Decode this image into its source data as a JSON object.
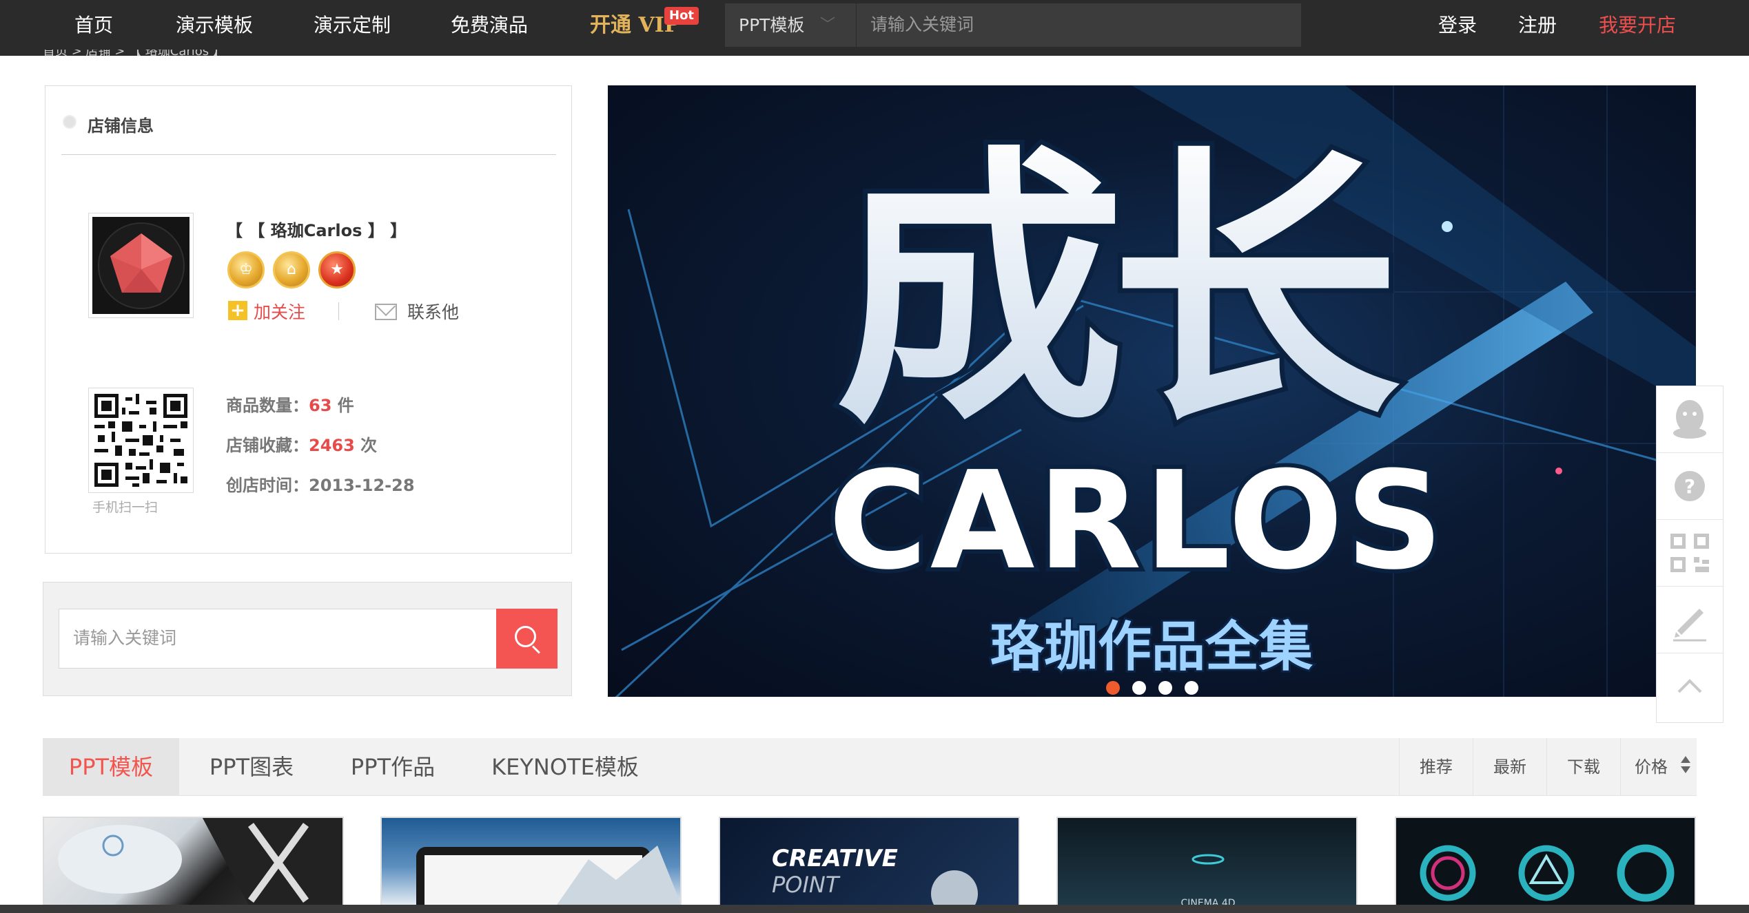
{
  "nav": {
    "items": [
      "首页",
      "演示模板",
      "演示定制",
      "免费演品"
    ],
    "vip_label": "开通 VIP",
    "hot_badge": "Hot",
    "search_category": "PPT模板",
    "search_placeholder": "请输入关键词",
    "login": "登录",
    "register": "注册",
    "open_shop": "我要开店"
  },
  "breadcrumb": "首页 > 店铺 > 【 珞珈Carlos 】",
  "shop": {
    "section_title": "店铺信息",
    "name": "【 【 珞珈Carlos 】 】",
    "follow": "加关注",
    "contact": "联系他",
    "qr_caption": "手机扫一扫",
    "goods_label": "商品数量：",
    "goods_value": "63",
    "goods_unit": " 件",
    "favs_label": "店铺收藏：",
    "favs_value": "2463",
    "favs_unit": " 次",
    "created_label": "创店时间：",
    "created_value": "2013-12-28"
  },
  "side_search": {
    "placeholder": "请输入关键词"
  },
  "banner": {
    "headline": "成长",
    "name": "CARLOS",
    "subtitle": "珞珈作品全集",
    "slide_count": 4,
    "active_slide": 1
  },
  "float_tools": [
    "qq-icon",
    "help-icon",
    "qrcode-icon",
    "edit-icon",
    "back-to-top-icon"
  ],
  "tabs": [
    "PPT模板",
    "PPT图表",
    "PPT作品",
    "KEYNOTE模板"
  ],
  "sorts": [
    "推荐",
    "最新",
    "下载",
    "价格"
  ],
  "thumbs": [
    {
      "text": ""
    },
    {
      "text": ""
    },
    {
      "text": "CREATIVE",
      "text2": "POINT"
    },
    {
      "text": "CINEMA 4D"
    },
    {
      "text": ""
    }
  ],
  "colors": {
    "accent": "#f1554f",
    "topbar": "#2b2b2b",
    "vip": "#e2b35a"
  }
}
